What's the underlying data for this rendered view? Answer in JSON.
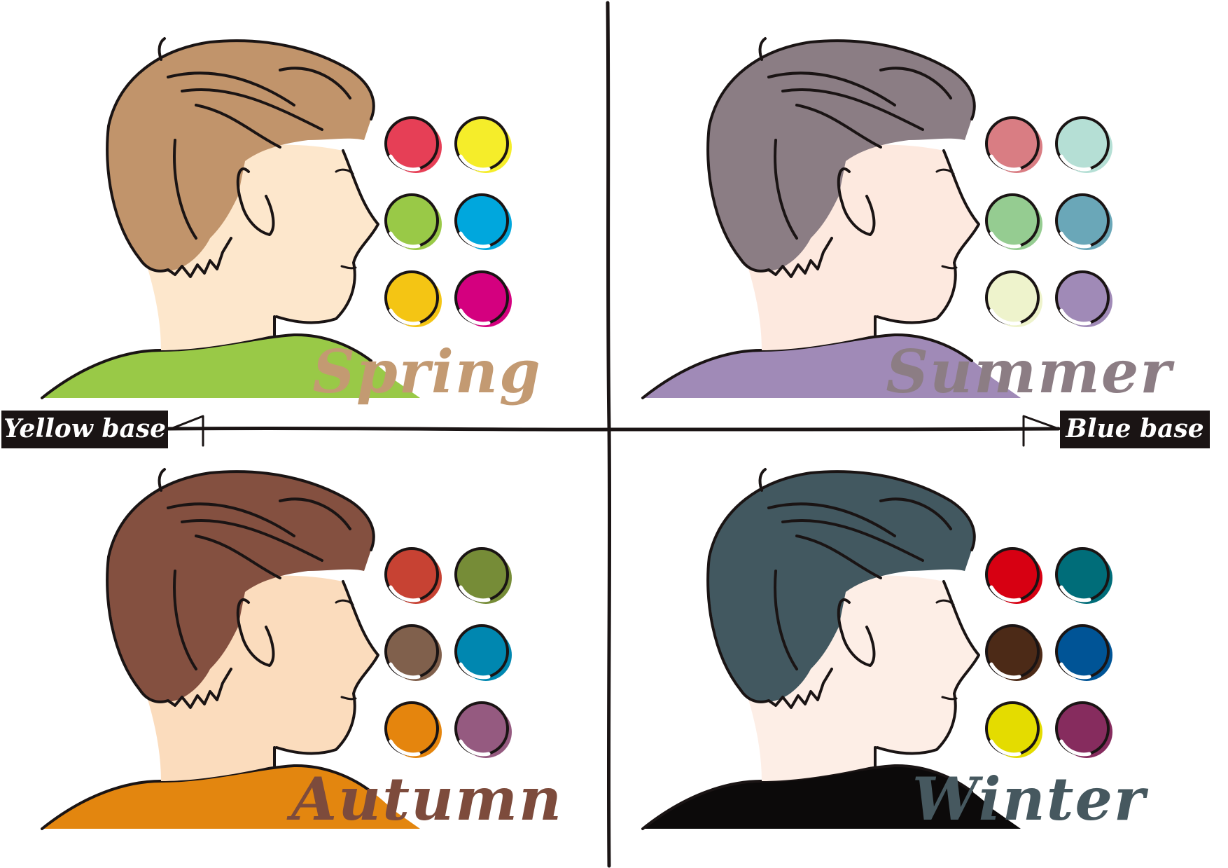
{
  "axis": {
    "left_label": "Yellow base",
    "right_label": "Blue base"
  },
  "quadrants": [
    {
      "id": "spring",
      "label": "Spring",
      "label_color": "#c39a72",
      "hair_color": "#c1946b",
      "skin_color": "#fde7cc",
      "shirt_color": "#99c947",
      "swatches": [
        "#e63f56",
        "#f5ed2a",
        "#99c947",
        "#00a7dd",
        "#f4c514",
        "#d4007f"
      ]
    },
    {
      "id": "summer",
      "label": "Summer",
      "label_color": "#8c7d84",
      "hair_color": "#8b7d84",
      "skin_color": "#fde9df",
      "shirt_color": "#a08ab7",
      "swatches": [
        "#d97d83",
        "#b5dfd5",
        "#95cc91",
        "#6aa7b8",
        "#eef3cc",
        "#a08ab7"
      ]
    },
    {
      "id": "autumn",
      "label": "Autumn",
      "label_color": "#7d4b3c",
      "hair_color": "#845040",
      "skin_color": "#fbdcbd",
      "shirt_color": "#e3860f",
      "swatches": [
        "#c74233",
        "#768c37",
        "#80604c",
        "#0087b0",
        "#e5850d",
        "#955a80"
      ]
    },
    {
      "id": "winter",
      "label": "Winter",
      "label_color": "#46585f",
      "hair_color": "#425860",
      "skin_color": "#fdeee6",
      "shirt_color": "#0c0a0a",
      "swatches": [
        "#d70012",
        "#006d79",
        "#4c2a17",
        "#005496",
        "#e4dc00",
        "#862c5e"
      ]
    }
  ]
}
